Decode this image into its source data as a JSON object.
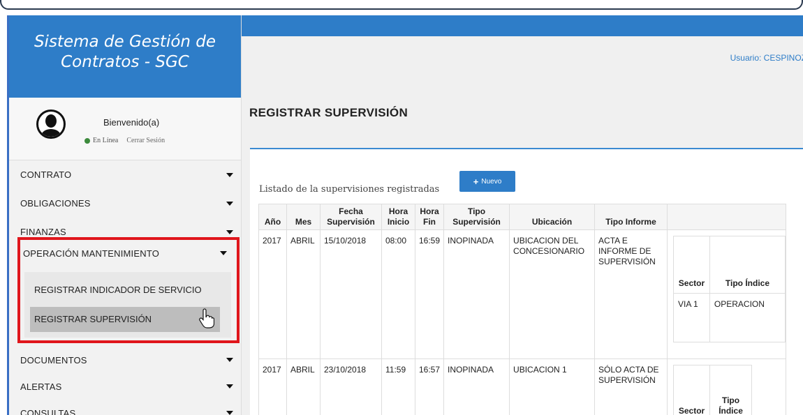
{
  "app": {
    "title": "Sistema de Gestión de Contratos - SGC"
  },
  "user": {
    "welcome": "Bienvenido(a)",
    "status": "En Línea",
    "logout": "Cerrar Sesión",
    "label": "Usuario: CESPINOZ"
  },
  "menu": {
    "contrato": "CONTRATO",
    "obligaciones": "OBLIGACIONES",
    "finanzas": "FINANZAS",
    "operacion": "OPERACIÓN MANTENIMIENTO",
    "sub1": "REGISTRAR INDICADOR DE SERVICIO",
    "sub2": "REGISTRAR SUPERVISIÓN",
    "documentos": "DOCUMENTOS",
    "alertas": "ALERTAS",
    "consultas": "CONSULTAS"
  },
  "page": {
    "title": "REGISTRAR SUPERVISIÓN",
    "list_label": "Listado de la supervisiones registradas",
    "new_button": "Nuevo"
  },
  "table": {
    "headers": {
      "anio": "Año",
      "mes": "Mes",
      "fecha": "Fecha Supervisión",
      "hora_inicio": "Hora Inicio",
      "hora_fin": "Hora Fin",
      "tipo_sup": "Tipo Supervisión",
      "ubicacion": "Ubicación",
      "tipo_informe": "Tipo Informe"
    },
    "rows": [
      {
        "anio": "2017",
        "mes": "ABRIL",
        "fecha": "15/10/2018",
        "hora_inicio": "08:00",
        "hora_fin": "16:59",
        "tipo": "INOPINADA",
        "ubicacion": "UBICACION DEL CONCESIONARIO",
        "informe": "ACTA E INFORME DE SUPERVISIÓN",
        "sector_header": "Sector",
        "indice_header": "Tipo Índice",
        "sector": "VIA 1",
        "indice": "OPERACION"
      },
      {
        "anio": "2017",
        "mes": "ABRIL",
        "fecha": "23/10/2018",
        "hora_inicio": "11:59",
        "hora_fin": "16:57",
        "tipo": "INOPINADA",
        "ubicacion": "UBICACION 1",
        "informe": "SÓLO ACTA DE SUPERVISIÓN",
        "sector_header": "Sector",
        "indice_header": "Tipo Índice"
      }
    ]
  }
}
